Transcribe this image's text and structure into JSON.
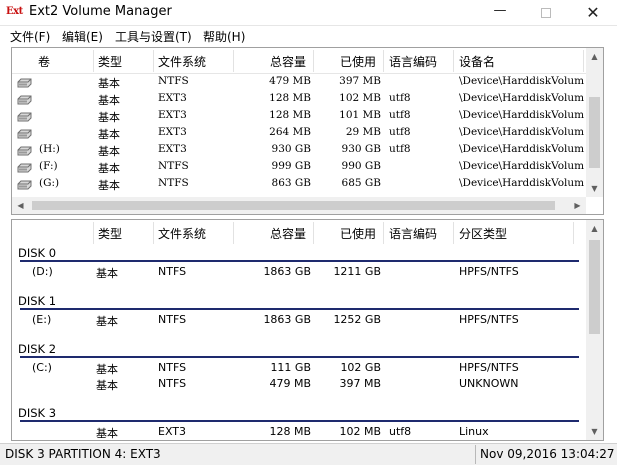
{
  "window": {
    "title": "Ext2 Volume Manager",
    "app_icon_text": "Ext",
    "minimize_glyph": "—",
    "close_glyph": "✕"
  },
  "menu": [
    {
      "label": "文件(F)"
    },
    {
      "label": "编辑(E)"
    },
    {
      "label": "工具与设置(T)"
    },
    {
      "label": "帮助(H)"
    }
  ],
  "volumes": {
    "columns": [
      "卷",
      "类型",
      "文件系统",
      "总容量",
      "已使用",
      "语言编码",
      "设备名"
    ],
    "rows": [
      {
        "volume": "",
        "type": "基本",
        "fs": "NTFS",
        "total": "479 MB",
        "used": "397 MB",
        "codepage": "",
        "device": "\\Device\\HarddiskVolum"
      },
      {
        "volume": "",
        "type": "基本",
        "fs": "EXT3",
        "total": "128 MB",
        "used": "102 MB",
        "codepage": "utf8",
        "device": "\\Device\\HarddiskVolum"
      },
      {
        "volume": "",
        "type": "基本",
        "fs": "EXT3",
        "total": "128 MB",
        "used": "101 MB",
        "codepage": "utf8",
        "device": "\\Device\\HarddiskVolum"
      },
      {
        "volume": "",
        "type": "基本",
        "fs": "EXT3",
        "total": "264 MB",
        "used": "29 MB",
        "codepage": "utf8",
        "device": "\\Device\\HarddiskVolum"
      },
      {
        "volume": "(H:)",
        "type": "基本",
        "fs": "EXT3",
        "total": "930 GB",
        "used": "930 GB",
        "codepage": "utf8",
        "device": "\\Device\\HarddiskVolum"
      },
      {
        "volume": "(F:)",
        "type": "基本",
        "fs": "NTFS",
        "total": "999 GB",
        "used": "990 GB",
        "codepage": "",
        "device": "\\Device\\HarddiskVolum"
      },
      {
        "volume": "(G:)",
        "type": "基本",
        "fs": "NTFS",
        "total": "863 GB",
        "used": "685 GB",
        "codepage": "",
        "device": "\\Device\\HarddiskVolum"
      }
    ]
  },
  "disks": {
    "columns": [
      "类型",
      "文件系统",
      "总容量",
      "已使用",
      "语言编码",
      "分区类型"
    ],
    "groups": [
      {
        "label": "DISK 0",
        "partitions": [
          {
            "volume": "(D:)",
            "type": "基本",
            "fs": "NTFS",
            "total": "1863 GB",
            "used": "1211 GB",
            "codepage": "",
            "ptype": "HPFS/NTFS"
          }
        ]
      },
      {
        "label": "DISK 1",
        "partitions": [
          {
            "volume": "(E:)",
            "type": "基本",
            "fs": "NTFS",
            "total": "1863 GB",
            "used": "1252 GB",
            "codepage": "",
            "ptype": "HPFS/NTFS"
          }
        ]
      },
      {
        "label": "DISK 2",
        "partitions": [
          {
            "volume": "(C:)",
            "type": "基本",
            "fs": "NTFS",
            "total": "111 GB",
            "used": "102 GB",
            "codepage": "",
            "ptype": "HPFS/NTFS"
          },
          {
            "volume": "",
            "type": "基本",
            "fs": "NTFS",
            "total": "479 MB",
            "used": "397 MB",
            "codepage": "",
            "ptype": "UNKNOWN"
          }
        ]
      },
      {
        "label": "DISK 3",
        "partitions": [
          {
            "volume": "",
            "type": "基本",
            "fs": "EXT3",
            "total": "128 MB",
            "used": "102 MB",
            "codepage": "utf8",
            "ptype": "Linux"
          }
        ]
      }
    ]
  },
  "status": {
    "selection": "DISK 3 PARTITION 4:  EXT3",
    "datetime": "Nov 09,2016 13:04:27"
  },
  "colors": {
    "disk_separator": "#1e2a6e",
    "app_icon": "#c81010"
  },
  "icons": {
    "drive": "hard-drive-icon",
    "up": "scroll-up-icon",
    "down": "scroll-down-icon",
    "left": "scroll-left-icon",
    "right": "scroll-right-icon"
  }
}
